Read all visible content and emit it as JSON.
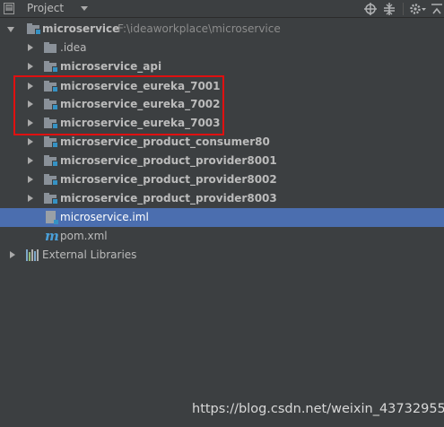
{
  "header": {
    "title": "Project",
    "icons": [
      "project-view-icon",
      "chevron-down-icon",
      "locate-target-icon",
      "collapse-all-icon",
      "settings-gear-icon",
      "hide-panel-icon"
    ]
  },
  "tree": {
    "root": {
      "name": "microservice",
      "path": "F:\\ideaworkplace\\microservice"
    },
    "items": [
      {
        "label": "microservice",
        "kind": "module-root"
      },
      {
        "label": ".idea",
        "kind": "folder"
      },
      {
        "label": "microservice_api",
        "kind": "module"
      },
      {
        "label": "microservice_eureka_7001",
        "kind": "module"
      },
      {
        "label": "microservice_eureka_7002",
        "kind": "module"
      },
      {
        "label": "microservice_eureka_7003",
        "kind": "module"
      },
      {
        "label": "microservice_product_consumer80",
        "kind": "module"
      },
      {
        "label": "microservice_product_provider8001",
        "kind": "module"
      },
      {
        "label": "microservice_product_provider8002",
        "kind": "module"
      },
      {
        "label": "microservice_product_provider8003",
        "kind": "module"
      },
      {
        "label": "microservice.iml",
        "kind": "iml-file"
      },
      {
        "label": "pom.xml",
        "kind": "maven-file"
      },
      {
        "label": "External Libraries",
        "kind": "libraries"
      }
    ],
    "selected": "microservice.iml"
  },
  "annotation": {
    "color": "#e01010"
  },
  "watermark": "https://blog.csdn.net/weixin_43732955",
  "colors": {
    "background": "#3c3f41",
    "selection": "#4b6eaf",
    "module_marker": "#3592c4",
    "text": "#bbbbbb"
  }
}
